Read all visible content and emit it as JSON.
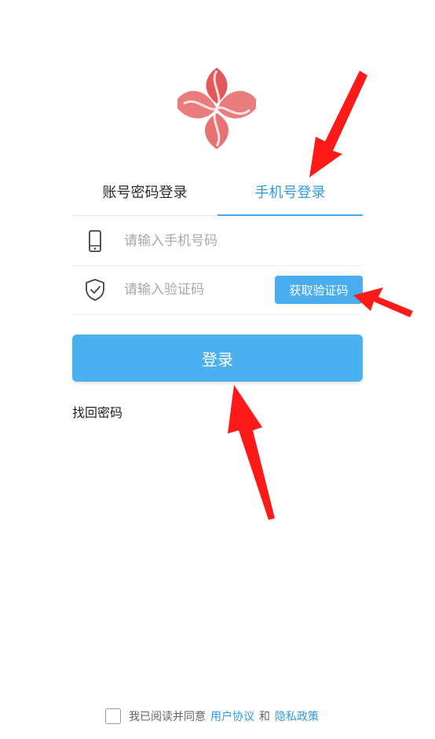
{
  "tabs": {
    "account_login": "账号密码登录",
    "phone_login": "手机号登录",
    "active": "phone_login"
  },
  "phone_field": {
    "placeholder": "请输入手机号码",
    "value": "",
    "icon": "phone-icon"
  },
  "code_field": {
    "placeholder": "请输入验证码",
    "value": "",
    "icon": "shield-check-icon",
    "get_code_label": "获取验证码"
  },
  "login_button": {
    "label": "登录"
  },
  "forgot_password": "找回密码",
  "agreement": {
    "checked": false,
    "prefix": "我已阅读并同意",
    "user_agreement": "用户协议",
    "and": "和",
    "privacy_policy": "隐私政策"
  },
  "colors": {
    "accent": "#4aaeee",
    "active_tab_text": "#2f9be2",
    "logo_red": "#e04848",
    "annotation_arrow": "#ff1a1a"
  }
}
